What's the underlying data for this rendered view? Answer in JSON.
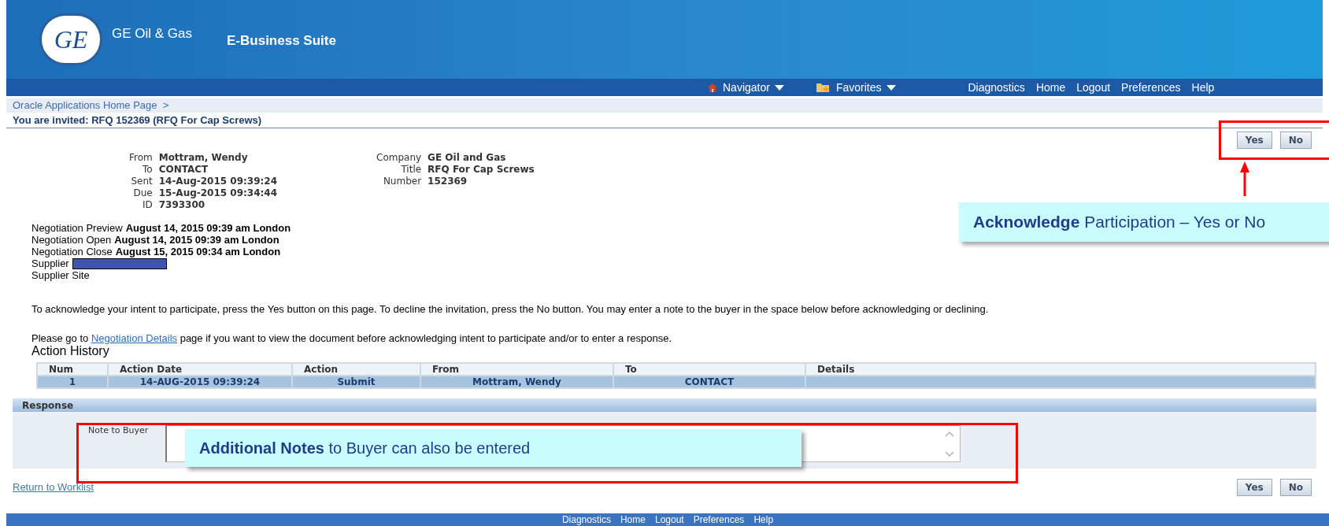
{
  "header": {
    "logo_text": "GE",
    "brand": "GE Oil & Gas",
    "app_title": "E-Business Suite"
  },
  "nav": {
    "menus": [
      {
        "label": "Navigator",
        "kind": "home"
      },
      {
        "label": "Favorites",
        "kind": "favorites"
      }
    ],
    "links": [
      "Diagnostics",
      "Home",
      "Logout",
      "Preferences",
      "Help"
    ]
  },
  "breadcrumb": "Oracle Applications Home Page  >",
  "page_title": "You are invited: RFQ 152369 (RFQ For Cap Screws)",
  "top_buttons": [
    "Yes",
    "No"
  ],
  "details_left": [
    {
      "label": "From",
      "value": "Mottram, Wendy"
    },
    {
      "label": "To",
      "value": "CONTACT"
    },
    {
      "label": "Sent",
      "value": "14-Aug-2015 09:39:24"
    },
    {
      "label": "Due",
      "value": "15-Aug-2015 09:34:44"
    },
    {
      "label": "ID",
      "value": "7393300"
    }
  ],
  "details_right": [
    {
      "label": "Company",
      "value": "GE Oil and Gas"
    },
    {
      "label": "Title",
      "value": "RFQ For Cap Screws"
    },
    {
      "label": "Number",
      "value": "152369"
    }
  ],
  "negotiation": [
    {
      "label": "Negotiation Preview",
      "value": "August 14, 2015 09:39 am London"
    },
    {
      "label": "Negotiation Open",
      "value": "August 14, 2015 09:39 am London"
    },
    {
      "label": "Negotiation Close",
      "value": "August 15, 2015 09:34 am London"
    }
  ],
  "supplier": {
    "label": "Supplier",
    "redacted": true
  },
  "supplier_site": {
    "label": "Supplier Site"
  },
  "instructions": "To acknowledge your intent to participate, press the Yes button on this page. To decline the invitation, press the No button. You may enter a note to the buyer in the space below before acknowledging or declining.",
  "details_link": {
    "prefix": "Please go to",
    "link": "Negotiation Details",
    "suffix": "page if you want to view the document before acknowledging intent to participate and/or to enter a response."
  },
  "action_history": {
    "title": "Action History",
    "columns": [
      "Num",
      "Action Date",
      "Action",
      "From",
      "To",
      "Details"
    ],
    "rows": [
      {
        "cells": [
          "1",
          "14-AUG-2015 09:39:24",
          "Submit",
          "Mottram, Wendy",
          "CONTACT",
          ""
        ],
        "selected": true
      }
    ]
  },
  "response": {
    "title": "Response",
    "note_label": "Note to Buyer"
  },
  "return_link": "Return to Worklist",
  "bottom_buttons": [
    "Yes",
    "No"
  ],
  "footer_links": [
    "Diagnostics",
    "Home",
    "Logout",
    "Preferences",
    "Help"
  ],
  "annotations": [
    {
      "text": "**Acknowledge** Participation – Yes or No"
    },
    {
      "text": "**Additional Notes** to Buyer can also be entered"
    }
  ]
}
